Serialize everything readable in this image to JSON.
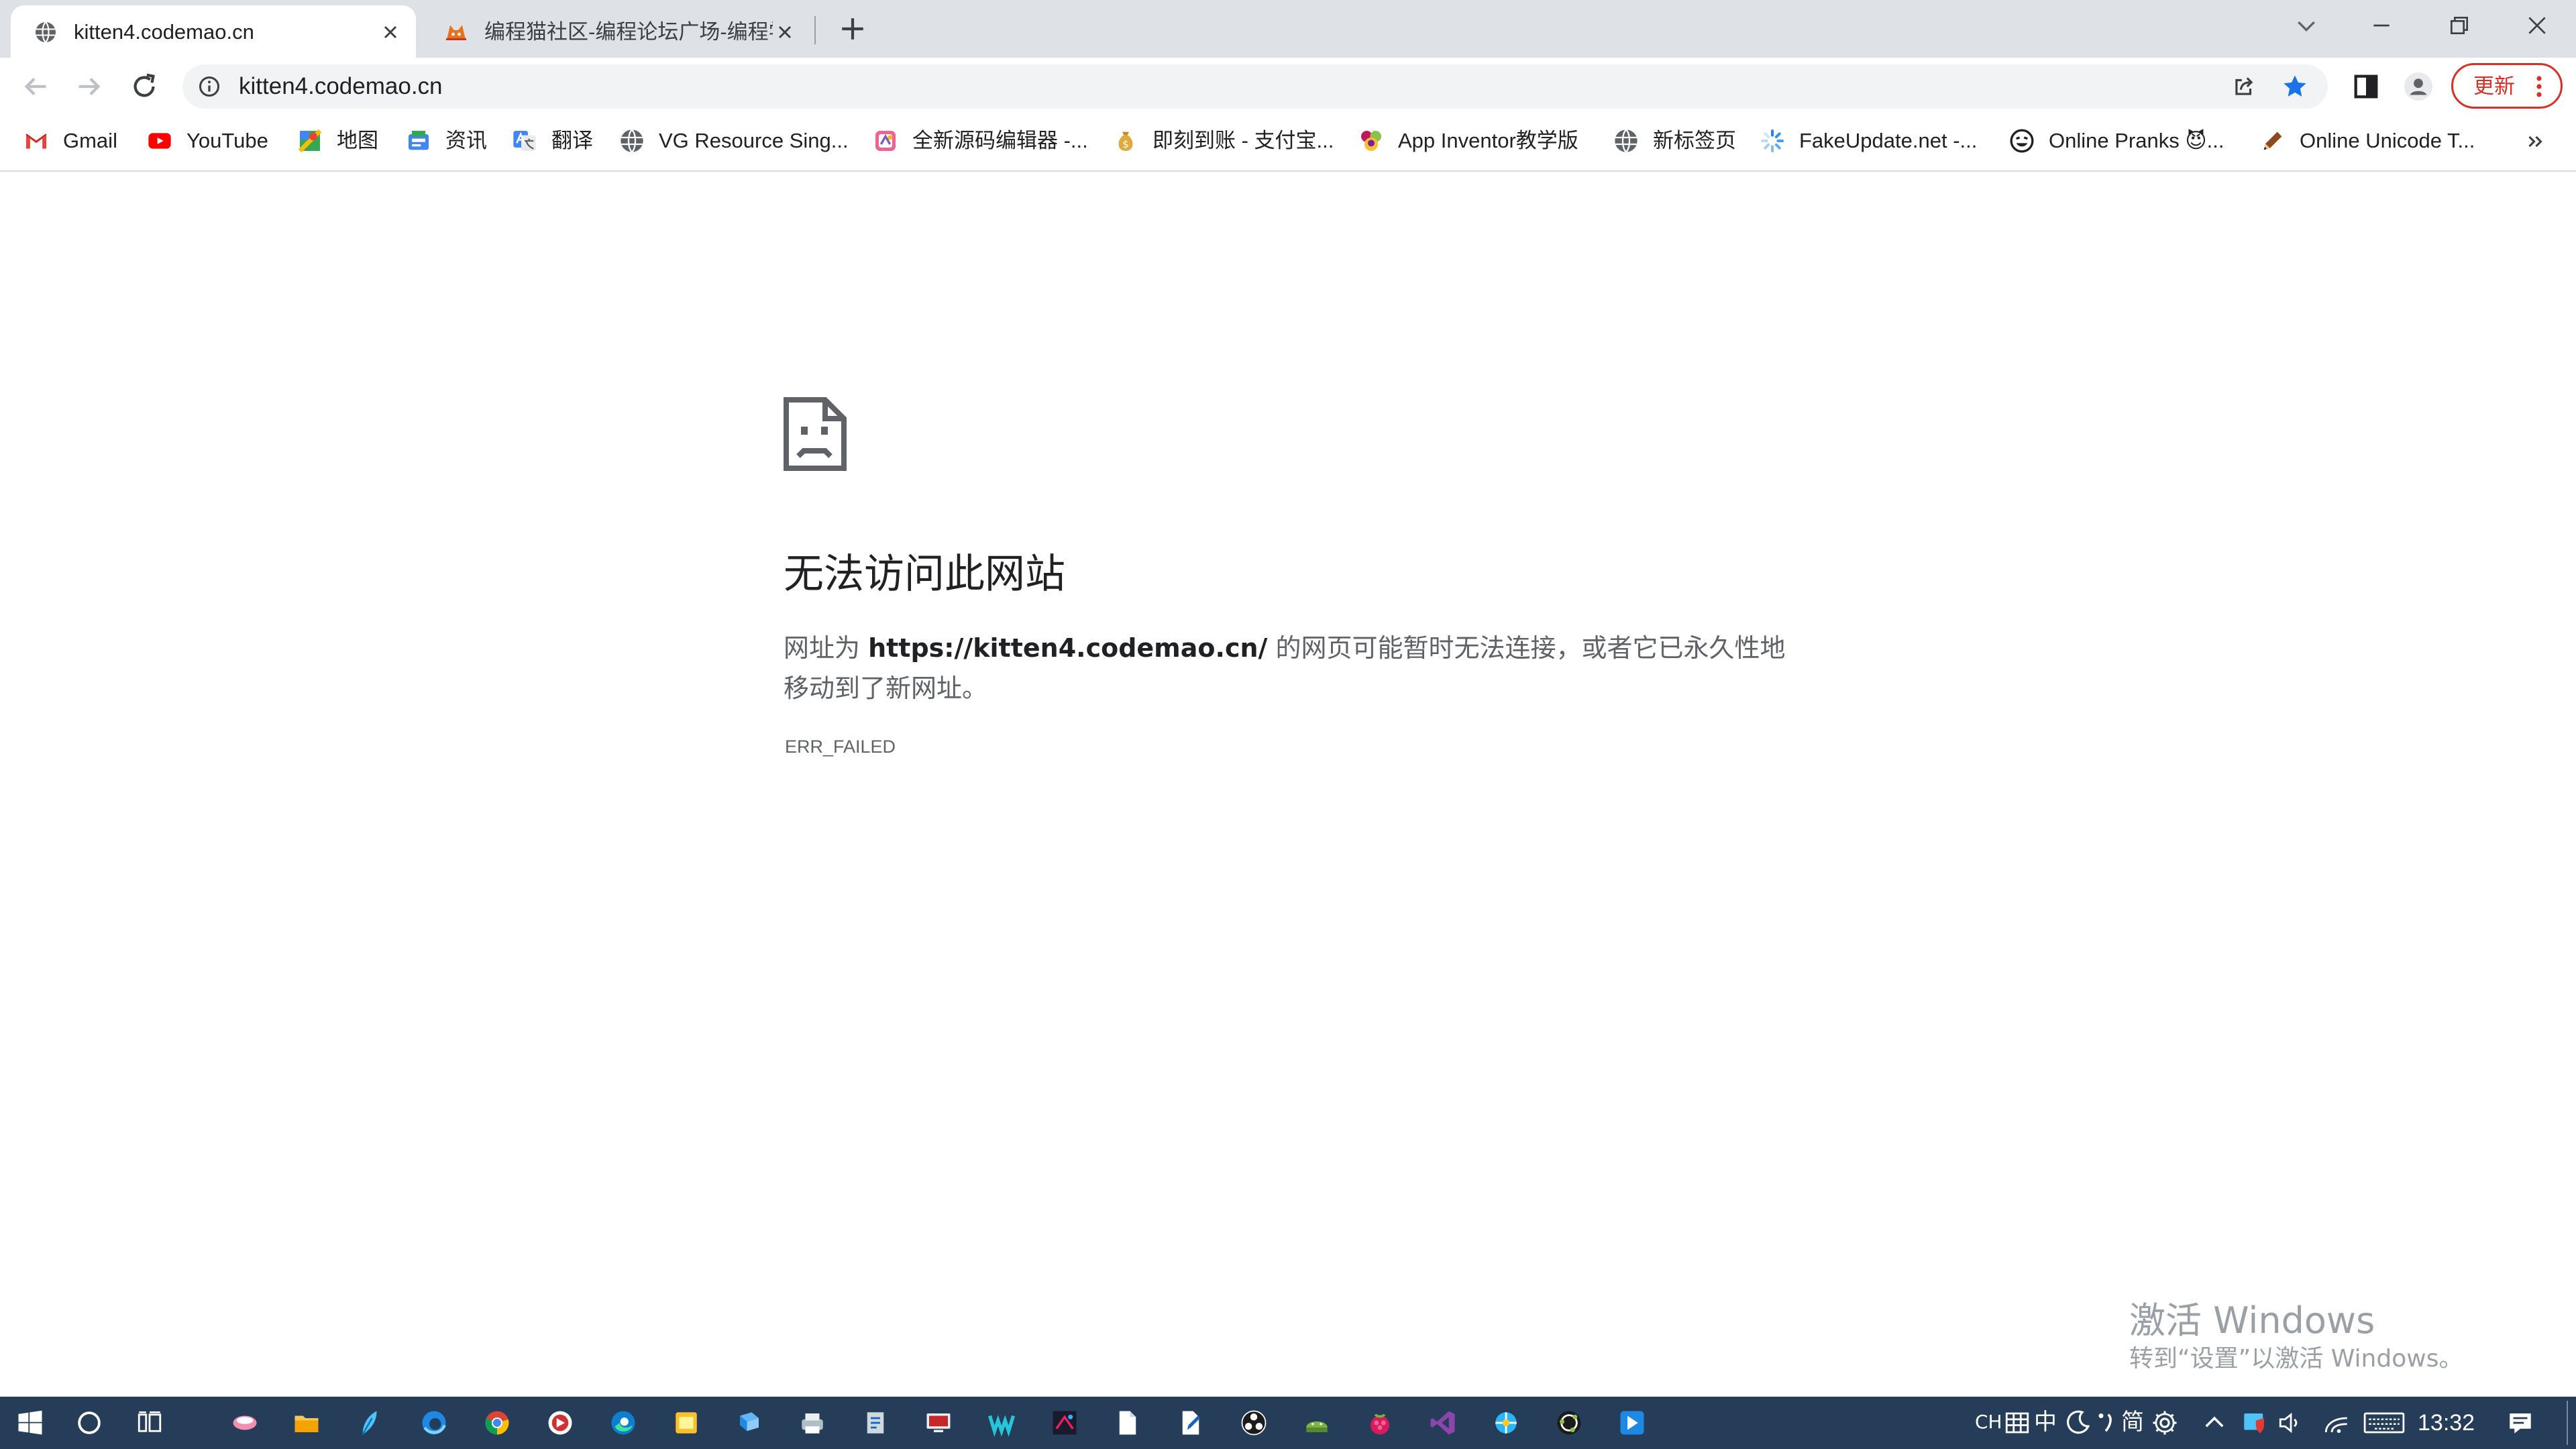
{
  "browser": {
    "tabs": [
      {
        "title": "kitten4.codemao.cn",
        "active": true,
        "favicon": "globe-icon"
      },
      {
        "title": "编程猫社区-编程论坛广场-编程学",
        "active": false,
        "favicon": "codemao-cat-icon"
      }
    ],
    "address_bar": {
      "url": "kitten4.codemao.cn"
    },
    "update_button_label": "更新",
    "bookmarks": [
      {
        "label": "Gmail",
        "icon": "gmail-icon"
      },
      {
        "label": "YouTube",
        "icon": "youtube-icon"
      },
      {
        "label": "地图",
        "icon": "maps-icon"
      },
      {
        "label": "资讯",
        "icon": "news-icon"
      },
      {
        "label": "翻译",
        "icon": "translate-icon"
      },
      {
        "label": "VG Resource Sing...",
        "icon": "globe-icon"
      },
      {
        "label": "全新源码编辑器 -...",
        "icon": "codemao-editor-icon"
      },
      {
        "label": "即刻到账 - 支付宝...",
        "icon": "money-bag-icon"
      },
      {
        "label": "App Inventor教学版",
        "icon": "app-inventor-icon"
      },
      {
        "label": "新标签页",
        "icon": "globe-icon"
      },
      {
        "label": "FakeUpdate.net -...",
        "icon": "loading-spinner-icon"
      },
      {
        "label": "Online Pranks 😈...",
        "icon": "prank-face-icon"
      },
      {
        "label": "Online Unicode T...",
        "icon": "pencil-icon"
      }
    ]
  },
  "error_page": {
    "title": "无法访问此网站",
    "desc_before": "网址为 ",
    "desc_url": "https://kitten4.codemao.cn/",
    "desc_after": " 的网页可能暂时无法连接，或者它已永久性地移动到了新网址。",
    "code": "ERR_FAILED"
  },
  "watermark": {
    "title": "激活 Windows",
    "subtitle": "转到“设置”以激活 Windows。"
  },
  "taskbar": {
    "tray": {
      "lang": "CH",
      "ime_mode": "中",
      "ime_width": "简",
      "time": "13:32"
    }
  },
  "colors": {
    "tab_strip": "#dee1e6",
    "update_accent": "#d93025",
    "star_blue": "#1a73e8",
    "taskbar": "#253d59"
  }
}
